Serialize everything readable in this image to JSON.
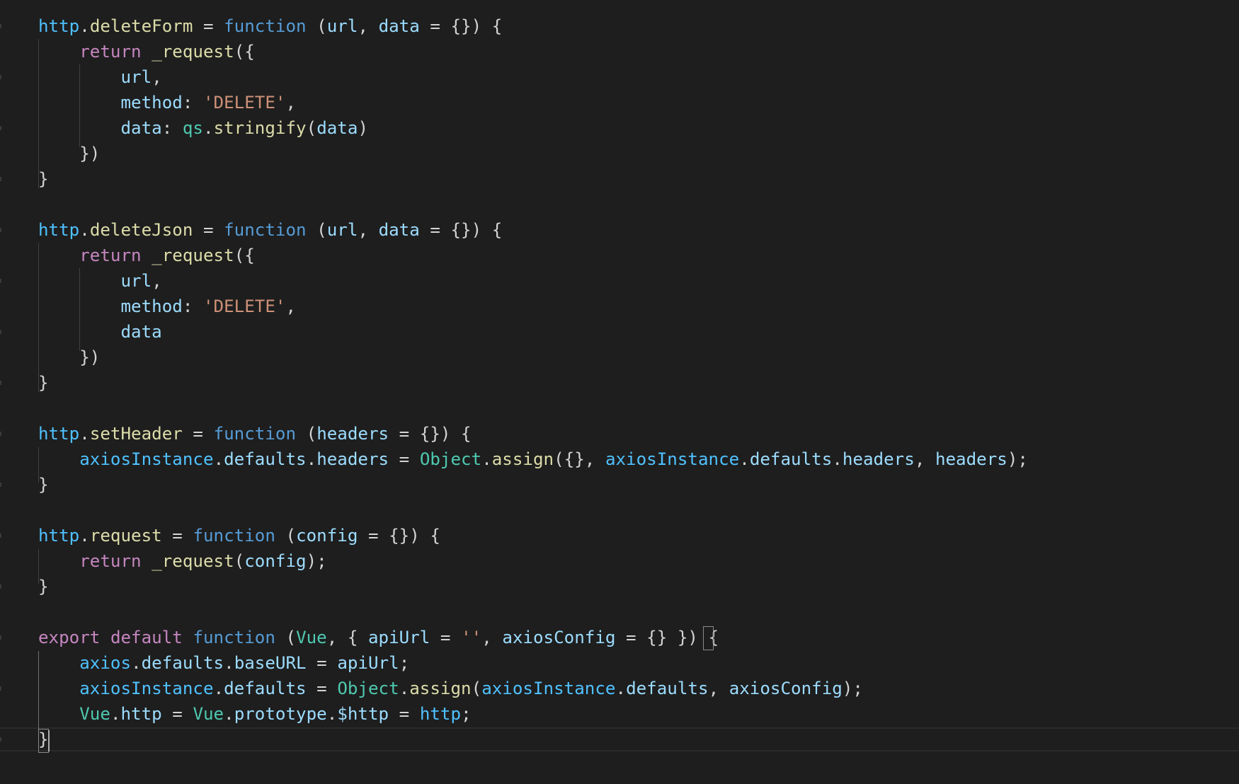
{
  "editor": {
    "colors": {
      "background": "#1e1e1e",
      "keyword_control": "#c586c0",
      "keyword_storage": "#569cd6",
      "variable": "#9cdcfe",
      "object": "#4fc1ff",
      "function": "#dcdcaa",
      "class": "#4ec9b0",
      "string": "#ce9178",
      "punctuation": "#d4d4d4"
    },
    "lines": [
      [
        [
          "http",
          "obj"
        ],
        [
          ".",
          "p"
        ],
        [
          "deleteForm",
          "fn"
        ],
        [
          " = ",
          "p"
        ],
        [
          "function",
          "kw"
        ],
        [
          " (",
          "p"
        ],
        [
          "url",
          "var"
        ],
        [
          ", ",
          "p"
        ],
        [
          "data",
          "var"
        ],
        [
          " = {}) {",
          "p"
        ]
      ],
      [
        [
          "    ",
          "p"
        ],
        [
          "return",
          "ctl"
        ],
        [
          " ",
          "p"
        ],
        [
          "_request",
          "fn"
        ],
        [
          "({",
          "p"
        ]
      ],
      [
        [
          "        ",
          "p"
        ],
        [
          "url",
          "var"
        ],
        [
          ",",
          "p"
        ]
      ],
      [
        [
          "        ",
          "p"
        ],
        [
          "method",
          "var"
        ],
        [
          ": ",
          "p"
        ],
        [
          "'DELETE'",
          "str"
        ],
        [
          ",",
          "p"
        ]
      ],
      [
        [
          "        ",
          "p"
        ],
        [
          "data",
          "var"
        ],
        [
          ": ",
          "p"
        ],
        [
          "qs",
          "cls"
        ],
        [
          ".",
          "p"
        ],
        [
          "stringify",
          "fn"
        ],
        [
          "(",
          "p"
        ],
        [
          "data",
          "var"
        ],
        [
          ")",
          "p"
        ]
      ],
      [
        [
          "    })",
          "p"
        ]
      ],
      [
        [
          "}",
          "p"
        ]
      ],
      [],
      [
        [
          "http",
          "obj"
        ],
        [
          ".",
          "p"
        ],
        [
          "deleteJson",
          "fn"
        ],
        [
          " = ",
          "p"
        ],
        [
          "function",
          "kw"
        ],
        [
          " (",
          "p"
        ],
        [
          "url",
          "var"
        ],
        [
          ", ",
          "p"
        ],
        [
          "data",
          "var"
        ],
        [
          " = {}) {",
          "p"
        ]
      ],
      [
        [
          "    ",
          "p"
        ],
        [
          "return",
          "ctl"
        ],
        [
          " ",
          "p"
        ],
        [
          "_request",
          "fn"
        ],
        [
          "({",
          "p"
        ]
      ],
      [
        [
          "        ",
          "p"
        ],
        [
          "url",
          "var"
        ],
        [
          ",",
          "p"
        ]
      ],
      [
        [
          "        ",
          "p"
        ],
        [
          "method",
          "var"
        ],
        [
          ": ",
          "p"
        ],
        [
          "'DELETE'",
          "str"
        ],
        [
          ",",
          "p"
        ]
      ],
      [
        [
          "        ",
          "p"
        ],
        [
          "data",
          "var"
        ]
      ],
      [
        [
          "    })",
          "p"
        ]
      ],
      [
        [
          "}",
          "p"
        ]
      ],
      [],
      [
        [
          "http",
          "obj"
        ],
        [
          ".",
          "p"
        ],
        [
          "setHeader",
          "fn"
        ],
        [
          " = ",
          "p"
        ],
        [
          "function",
          "kw"
        ],
        [
          " (",
          "p"
        ],
        [
          "headers",
          "var"
        ],
        [
          " = {}) {",
          "p"
        ]
      ],
      [
        [
          "    ",
          "p"
        ],
        [
          "axiosInstance",
          "obj"
        ],
        [
          ".",
          "p"
        ],
        [
          "defaults",
          "var"
        ],
        [
          ".",
          "p"
        ],
        [
          "headers",
          "var"
        ],
        [
          " = ",
          "p"
        ],
        [
          "Object",
          "cls"
        ],
        [
          ".",
          "p"
        ],
        [
          "assign",
          "fn"
        ],
        [
          "({}, ",
          "p"
        ],
        [
          "axiosInstance",
          "obj"
        ],
        [
          ".",
          "p"
        ],
        [
          "defaults",
          "var"
        ],
        [
          ".",
          "p"
        ],
        [
          "headers",
          "var"
        ],
        [
          ", ",
          "p"
        ],
        [
          "headers",
          "var"
        ],
        [
          ");",
          "p"
        ]
      ],
      [
        [
          "}",
          "p"
        ]
      ],
      [],
      [
        [
          "http",
          "obj"
        ],
        [
          ".",
          "p"
        ],
        [
          "request",
          "fn"
        ],
        [
          " = ",
          "p"
        ],
        [
          "function",
          "kw"
        ],
        [
          " (",
          "p"
        ],
        [
          "config",
          "var"
        ],
        [
          " = {}) {",
          "p"
        ]
      ],
      [
        [
          "    ",
          "p"
        ],
        [
          "return",
          "ctl"
        ],
        [
          " ",
          "p"
        ],
        [
          "_request",
          "fn"
        ],
        [
          "(",
          "p"
        ],
        [
          "config",
          "var"
        ],
        [
          ");",
          "p"
        ]
      ],
      [
        [
          "}",
          "p"
        ]
      ],
      [],
      [
        [
          "export",
          "ctl"
        ],
        [
          " ",
          "p"
        ],
        [
          "default",
          "ctl"
        ],
        [
          " ",
          "p"
        ],
        [
          "function",
          "kw"
        ],
        [
          " (",
          "p"
        ],
        [
          "Vue",
          "cls"
        ],
        [
          ", { ",
          "p"
        ],
        [
          "apiUrl",
          "var"
        ],
        [
          " = ",
          "p"
        ],
        [
          "''",
          "str"
        ],
        [
          ", ",
          "p"
        ],
        [
          "axiosConfig",
          "var"
        ],
        [
          " = {} }) {",
          "p"
        ]
      ],
      [
        [
          "    ",
          "p"
        ],
        [
          "axios",
          "obj"
        ],
        [
          ".",
          "p"
        ],
        [
          "defaults",
          "var"
        ],
        [
          ".",
          "p"
        ],
        [
          "baseURL",
          "var"
        ],
        [
          " = ",
          "p"
        ],
        [
          "apiUrl",
          "var"
        ],
        [
          ";",
          "p"
        ]
      ],
      [
        [
          "    ",
          "p"
        ],
        [
          "axiosInstance",
          "obj"
        ],
        [
          ".",
          "p"
        ],
        [
          "defaults",
          "var"
        ],
        [
          " = ",
          "p"
        ],
        [
          "Object",
          "cls"
        ],
        [
          ".",
          "p"
        ],
        [
          "assign",
          "fn"
        ],
        [
          "(",
          "p"
        ],
        [
          "axiosInstance",
          "obj"
        ],
        [
          ".",
          "p"
        ],
        [
          "defaults",
          "var"
        ],
        [
          ", ",
          "p"
        ],
        [
          "axiosConfig",
          "var"
        ],
        [
          ");",
          "p"
        ]
      ],
      [
        [
          "    ",
          "p"
        ],
        [
          "Vue",
          "cls"
        ],
        [
          ".",
          "p"
        ],
        [
          "http",
          "var"
        ],
        [
          " = ",
          "p"
        ],
        [
          "Vue",
          "cls"
        ],
        [
          ".",
          "p"
        ],
        [
          "prototype",
          "var"
        ],
        [
          ".",
          "p"
        ],
        [
          "$http",
          "var"
        ],
        [
          " = ",
          "p"
        ],
        [
          "http",
          "obj"
        ],
        [
          ";",
          "p"
        ]
      ],
      [
        [
          "}",
          "p"
        ]
      ]
    ]
  }
}
